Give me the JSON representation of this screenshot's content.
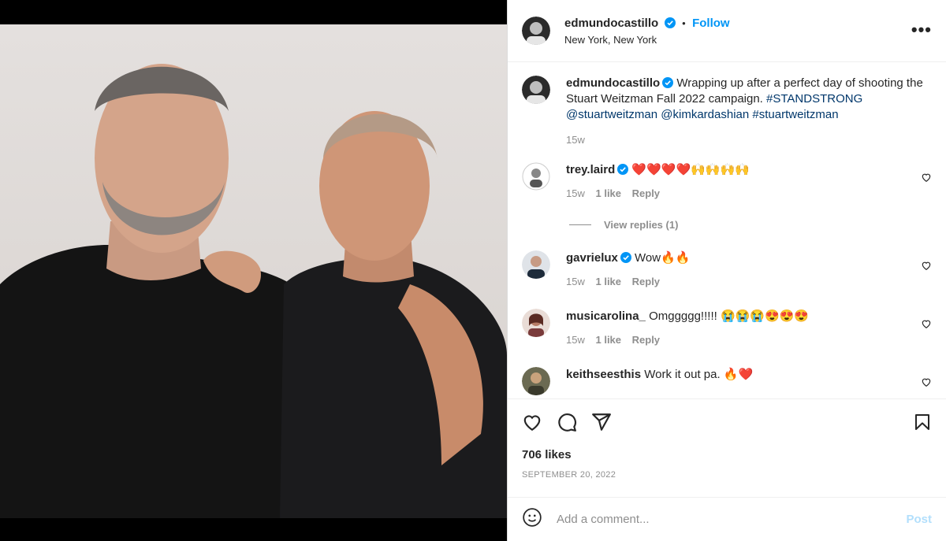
{
  "post": {
    "username": "edmundocastillo",
    "follow_label": "Follow",
    "separator": "•",
    "location": "New York, New York",
    "more_label": "•••"
  },
  "caption": {
    "username": "edmundocastillo",
    "text": "Wrapping up after a perfect day of shooting the Stuart Weitzman Fall 2022 campaign.",
    "hashtag1": "#STANDSTRONG",
    "mention1": "@stuartweitzman",
    "mention2": "@kimkardashian",
    "hashtag2": "#stuartweitzman",
    "age": "15w"
  },
  "comments": [
    {
      "username": "trey.laird",
      "text": "❤️❤️❤️❤️🙌🙌🙌🙌",
      "age": "15w",
      "likes": "1 like",
      "reply": "Reply",
      "view_replies": "View replies (1)"
    },
    {
      "username": "gavrielux",
      "text": "Wow🔥🔥",
      "age": "15w",
      "likes": "1 like",
      "reply": "Reply"
    },
    {
      "username": "musicarolina_",
      "text": "Omggggg!!!!! 😭😭😭😍😍😍",
      "age": "15w",
      "likes": "1 like",
      "reply": "Reply"
    },
    {
      "username": "keithseesthis",
      "text": "Work it out pa. 🔥❤️"
    }
  ],
  "footer": {
    "likes": "706 likes",
    "date": "SEPTEMBER 20, 2022",
    "add_comment_placeholder": "Add a comment...",
    "post_label": "Post"
  },
  "colors": {
    "accent": "#0095f6",
    "link": "#00376b"
  },
  "icons": [
    "heart-icon",
    "comment-icon",
    "share-icon",
    "save-icon",
    "emoji-icon",
    "verified-icon",
    "more-icon"
  ]
}
